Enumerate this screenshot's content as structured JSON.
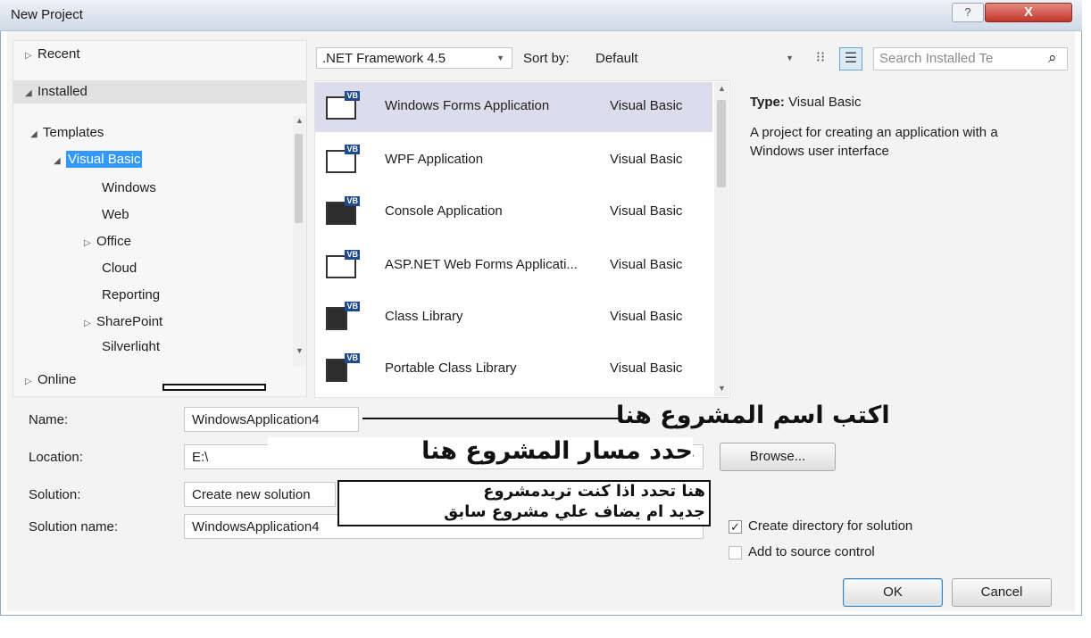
{
  "window": {
    "title": "New Project",
    "help_glyph": "?",
    "close_glyph": "X"
  },
  "tree": {
    "recent": "Recent",
    "installed": "Installed",
    "templates": "Templates",
    "visual_basic": "Visual Basic",
    "children": [
      "Windows",
      "Web",
      "Office",
      "Cloud",
      "Reporting",
      "SharePoint",
      "Silverlight"
    ],
    "online": "Online"
  },
  "toolbar": {
    "framework": ".NET Framework 4.5",
    "sort_label": "Sort by:",
    "sort_value": "Default",
    "search_placeholder": "Search Installed Te"
  },
  "templates": [
    {
      "name": "Windows Forms Application",
      "lang": "Visual Basic"
    },
    {
      "name": "WPF Application",
      "lang": "Visual Basic"
    },
    {
      "name": "Console Application",
      "lang": "Visual Basic"
    },
    {
      "name": "ASP.NET Web Forms Applicati...",
      "lang": "Visual Basic"
    },
    {
      "name": "Class Library",
      "lang": "Visual Basic"
    },
    {
      "name": "Portable Class Library",
      "lang": "Visual Basic"
    }
  ],
  "template_badge": "VB",
  "details": {
    "type_label": "Type:",
    "type_value": "Visual Basic",
    "description": "A project for creating an application with a Windows user interface"
  },
  "form": {
    "name_label": "Name:",
    "name_value": "WindowsApplication4",
    "location_label": "Location:",
    "location_value": "E:\\",
    "solution_label": "Solution:",
    "solution_value": "Create new solution",
    "solution_name_label": "Solution name:",
    "solution_name_value": "WindowsApplication4",
    "browse": "Browse...",
    "create_dir": "Create directory for solution",
    "add_source": "Add to source control",
    "ok": "OK",
    "cancel": "Cancel"
  },
  "annotations": {
    "name_note": "اكتب اسم المشروع هنا",
    "location_note": "حدد مسار المشروع هنا",
    "solution_note_line1": "هنا تحدد اذا كنت تريدمشروع",
    "solution_note_line2": "جديد ام يضاف علي مشروع سابق"
  },
  "colors": {
    "selection": "#3399ff",
    "selected_row": "#dcdcec",
    "vb_badge": "#1f4a8c",
    "close_button": "#c2362b"
  }
}
